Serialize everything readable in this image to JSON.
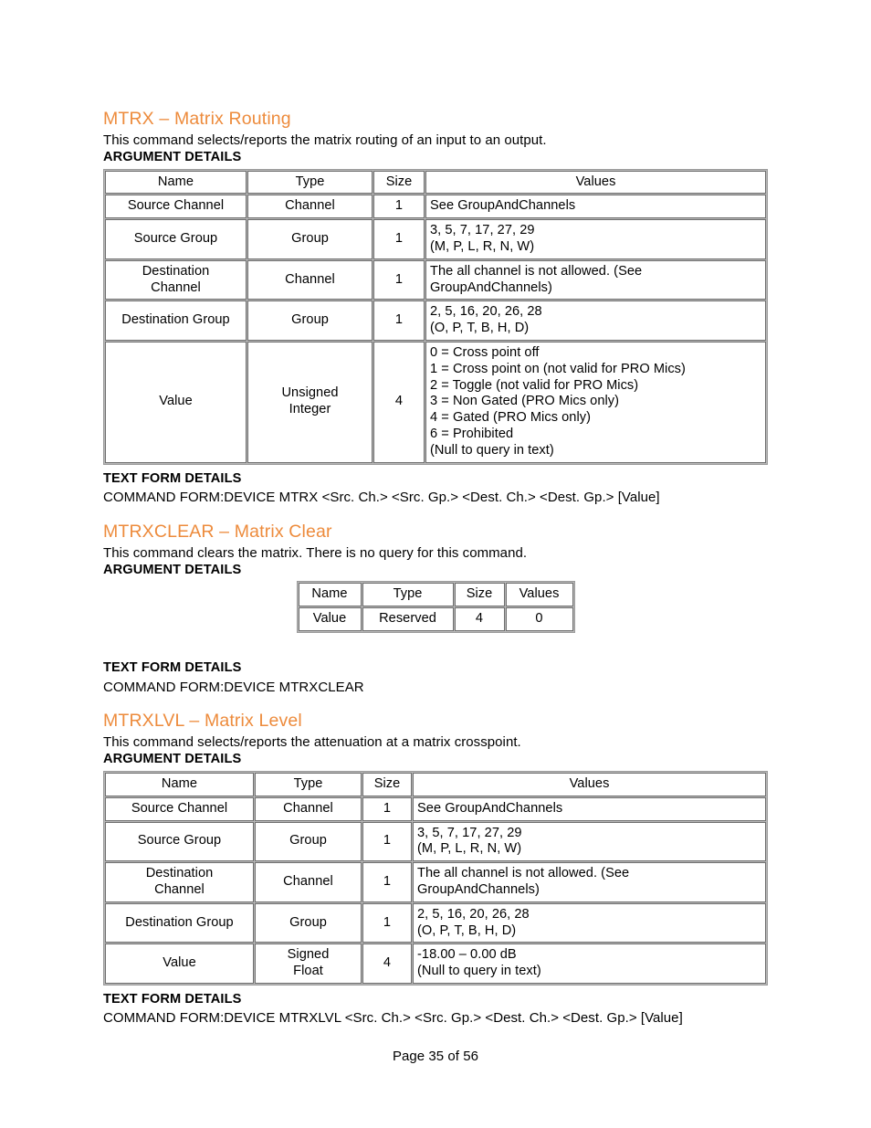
{
  "document": {
    "footer": "Page 35 of 56",
    "accent_color": "#ED8B3C",
    "section_label_argument": "ARGUMENT DETAILS",
    "section_label_textform": "TEXT FORM DETAILS"
  },
  "sections": [
    {
      "heading": "MTRX – Matrix Routing",
      "description": "This command selects/reports the matrix routing of an input to an output.",
      "argument_label": "ARGUMENT DETAILS",
      "table": {
        "headers": [
          "Name",
          "Type",
          "Size",
          "Values"
        ],
        "rows": [
          {
            "name": "Source Channel",
            "type": "Channel",
            "size": "1",
            "values": "See GroupAndChannels"
          },
          {
            "name": "Source Group",
            "type": "Group",
            "size": "1",
            "values": "3, 5, 7, 17, 27, 29\n(M, P, L, R, N, W)"
          },
          {
            "name": "Destination\nChannel",
            "type": "Channel",
            "size": "1",
            "values": "The all channel is not allowed. (See\nGroupAndChannels)"
          },
          {
            "name": "Destination Group",
            "type": "Group",
            "size": "1",
            "values": "2, 5, 16, 20, 26, 28\n(O, P, T, B, H, D)"
          },
          {
            "name": "Value",
            "type": "Unsigned\nInteger",
            "size": "4",
            "values": "0 = Cross point off\n1 = Cross point on (not valid for PRO Mics)\n2 = Toggle (not valid for PRO Mics)\n3 = Non Gated (PRO Mics only)\n4 = Gated (PRO Mics only)\n6 = Prohibited\n(Null to query in text)"
          }
        ]
      },
      "textform_label": "TEXT FORM DETAILS",
      "command_form": "COMMAND FORM:DEVICE MTRX <Src. Ch.> <Src. Gp.> <Dest. Ch.> <Dest. Gp.> [Value]"
    },
    {
      "heading": "MTRXCLEAR – Matrix Clear",
      "description": "This command clears the matrix. There is no query for this command.",
      "argument_label": "ARGUMENT DETAILS",
      "table": {
        "headers": [
          "Name",
          "Type",
          "Size",
          "Values"
        ],
        "rows": [
          {
            "name": "Value",
            "type": "Reserved",
            "size": "4",
            "values": "0"
          }
        ]
      },
      "textform_label": "TEXT FORM DETAILS",
      "command_form": "COMMAND FORM:DEVICE MTRXCLEAR"
    },
    {
      "heading": "MTRXLVL – Matrix Level",
      "description": "This command selects/reports the attenuation at a matrix crosspoint.",
      "argument_label": "ARGUMENT DETAILS",
      "table": {
        "headers": [
          "Name",
          "Type",
          "Size",
          "Values"
        ],
        "rows": [
          {
            "name": "Source Channel",
            "type": "Channel",
            "size": "1",
            "values": "See GroupAndChannels"
          },
          {
            "name": "Source Group",
            "type": "Group",
            "size": "1",
            "values": "3, 5, 7, 17, 27, 29\n(M, P, L, R, N, W)"
          },
          {
            "name": "Destination\nChannel",
            "type": "Channel",
            "size": "1",
            "values": "The all channel is not allowed. (See\nGroupAndChannels)"
          },
          {
            "name": "Destination Group",
            "type": "Group",
            "size": "1",
            "values": "2, 5, 16, 20, 26, 28\n(O, P, T, B, H, D)"
          },
          {
            "name": "Value",
            "type": "Signed\nFloat",
            "size": "4",
            "values": "-18.00 – 0.00 dB\n(Null to query in text)"
          }
        ]
      },
      "textform_label": "TEXT FORM DETAILS",
      "command_form": "COMMAND FORM:DEVICE MTRXLVL <Src. Ch.> <Src. Gp.> <Dest. Ch.> <Dest. Gp.> [Value]"
    }
  ]
}
